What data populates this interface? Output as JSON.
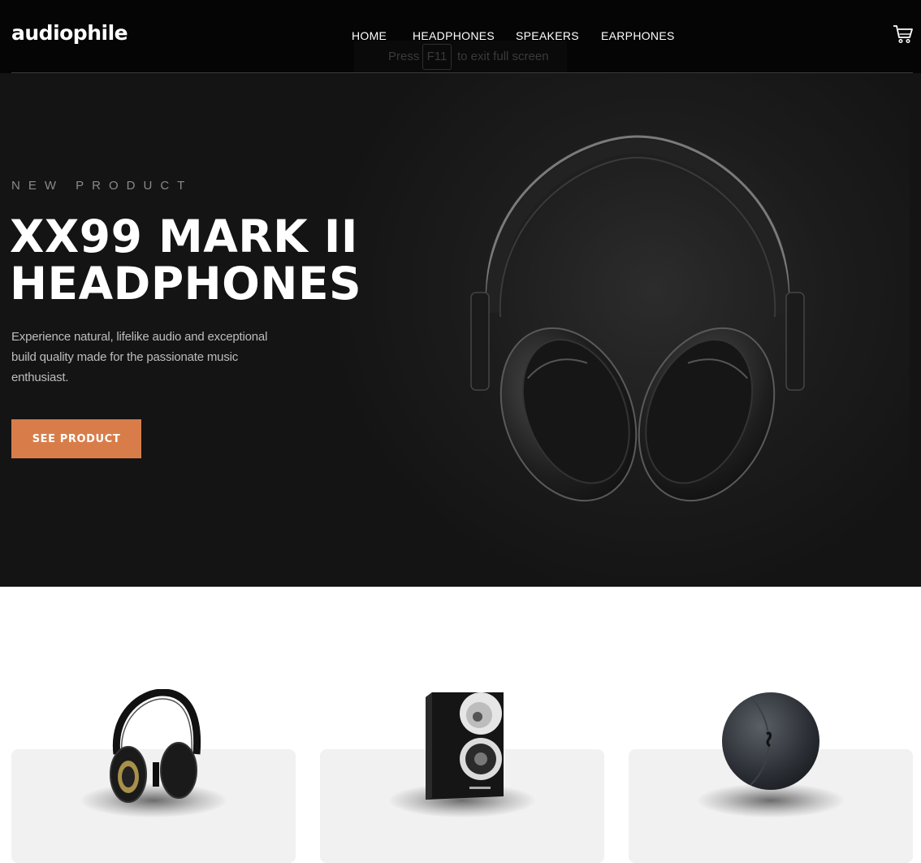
{
  "header": {
    "logo": "audiophile",
    "nav": [
      "HOME",
      "HEADPHONES",
      "SPEAKERS",
      "EARPHONES"
    ],
    "cart_icon": "cart-icon"
  },
  "fullscreen_notice": {
    "before": "Press",
    "key": "F11",
    "after": "to exit full screen"
  },
  "hero": {
    "overline": "NEW PRODUCT",
    "title_line1": "XX99 MARK II",
    "title_line2": "HEADPHONES",
    "description": "Experience natural, lifelike audio and exceptional build quality made for the passionate music enthusiast.",
    "button_label": "SEE PRODUCT",
    "image": "headphones-image"
  },
  "categories": [
    {
      "image": "headphones-image"
    },
    {
      "image": "speaker-image"
    },
    {
      "image": "earphones-image"
    }
  ],
  "colors": {
    "accent": "#D87D4A",
    "dark": "#141414",
    "card_bg": "#F1F1F1"
  }
}
